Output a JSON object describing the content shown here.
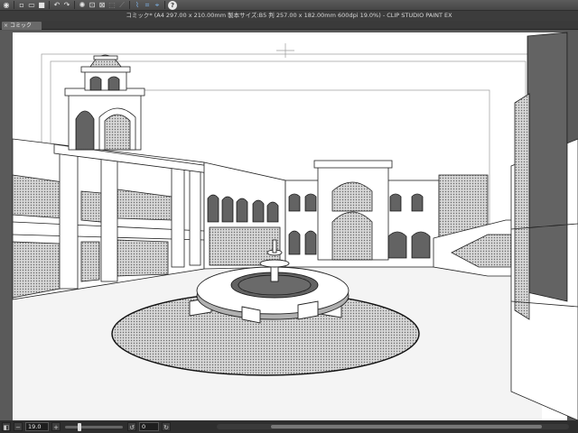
{
  "app": {
    "title": "コミック* (A4 297.00 x 210.00mm 製本サイズ:B5 判 257.00 x 182.00mm 600dpi 19.0%) - CLIP STUDIO PAINT EX"
  },
  "tabs": [
    {
      "label": "コミック"
    }
  ],
  "toolbar": {
    "icons": [
      "clip-studio-icon",
      "new-icon",
      "open-icon",
      "save-icon",
      "undo-icon",
      "redo-icon",
      "clear-icon",
      "transform-icon",
      "deselect-icon",
      "invert-icon",
      "ruler-icon",
      "snap-icon",
      "snap-grid-icon",
      "snap-ruler-icon",
      "help-icon"
    ]
  },
  "statusbar": {
    "zoom": "19.0",
    "angle": "0"
  },
  "colors": {
    "ui_background": "#555555",
    "titlebar": "#3c3c3c",
    "paper": "#ffffff"
  }
}
